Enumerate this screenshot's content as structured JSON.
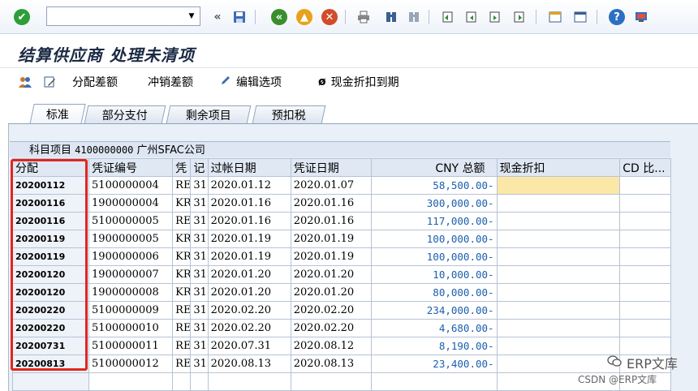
{
  "toolbar": {
    "command_field_value": "",
    "command_field_placeholder": "",
    "colors": {
      "enter": "#2e9e3a",
      "back": "#3a8f2c",
      "exit": "#e8a21a",
      "cancel": "#d24b2b",
      "help": "#2c6fc2"
    }
  },
  "screen": {
    "title": "结算供应商 处理未清项"
  },
  "app_toolbar": {
    "distribute_diff": "分配差额",
    "write_off_diff": "冲销差额",
    "edit_options": "编辑选项",
    "cash_discount_due": "现金折扣到期"
  },
  "tabs": [
    {
      "label": "标准",
      "active": true
    },
    {
      "label": "部分支付",
      "active": false
    },
    {
      "label": "剩余项目",
      "active": false
    },
    {
      "label": "预扣税",
      "active": false
    }
  ],
  "account": {
    "label": "科目项目",
    "number": "4100000000",
    "name": "广州SFAC公司"
  },
  "table": {
    "columns": [
      "分配",
      "凭证编号",
      "凭",
      "记",
      "过帐日期",
      "凭证日期",
      "CNY 总额",
      "现金折扣",
      "CD 比..."
    ],
    "rows": [
      [
        "20200112",
        "5100000004",
        "RE",
        "31",
        "2020.01.12",
        "2020.01.07",
        "58,500.00-",
        "",
        ""
      ],
      [
        "20200116",
        "1900000004",
        "KR",
        "31",
        "2020.01.16",
        "2020.01.16",
        "300,000.00-",
        "",
        ""
      ],
      [
        "20200116",
        "5100000005",
        "RE",
        "31",
        "2020.01.16",
        "2020.01.16",
        "117,000.00-",
        "",
        ""
      ],
      [
        "20200119",
        "1900000005",
        "KR",
        "31",
        "2020.01.19",
        "2020.01.19",
        "100,000.00-",
        "",
        ""
      ],
      [
        "20200119",
        "1900000006",
        "KR",
        "31",
        "2020.01.19",
        "2020.01.19",
        "100,000.00-",
        "",
        ""
      ],
      [
        "20200120",
        "1900000007",
        "KR",
        "31",
        "2020.01.20",
        "2020.01.20",
        "10,000.00-",
        "",
        ""
      ],
      [
        "20200120",
        "1900000008",
        "KR",
        "31",
        "2020.01.20",
        "2020.01.20",
        "80,000.00-",
        "",
        ""
      ],
      [
        "20200220",
        "5100000009",
        "RE",
        "31",
        "2020.02.20",
        "2020.02.20",
        "234,000.00-",
        "",
        ""
      ],
      [
        "20200220",
        "5100000010",
        "RE",
        "31",
        "2020.02.20",
        "2020.02.20",
        "4,680.00-",
        "",
        ""
      ],
      [
        "20200731",
        "5100000011",
        "RE",
        "31",
        "2020.07.31",
        "2020.08.12",
        "8,190.00-",
        "",
        ""
      ],
      [
        "20200813",
        "5100000012",
        "RE",
        "31",
        "2020.08.13",
        "2020.08.13",
        "23,400.00-",
        "",
        ""
      ]
    ]
  },
  "watermark": {
    "main": "ERP文库",
    "sub": "CSDN @ERP文库"
  }
}
